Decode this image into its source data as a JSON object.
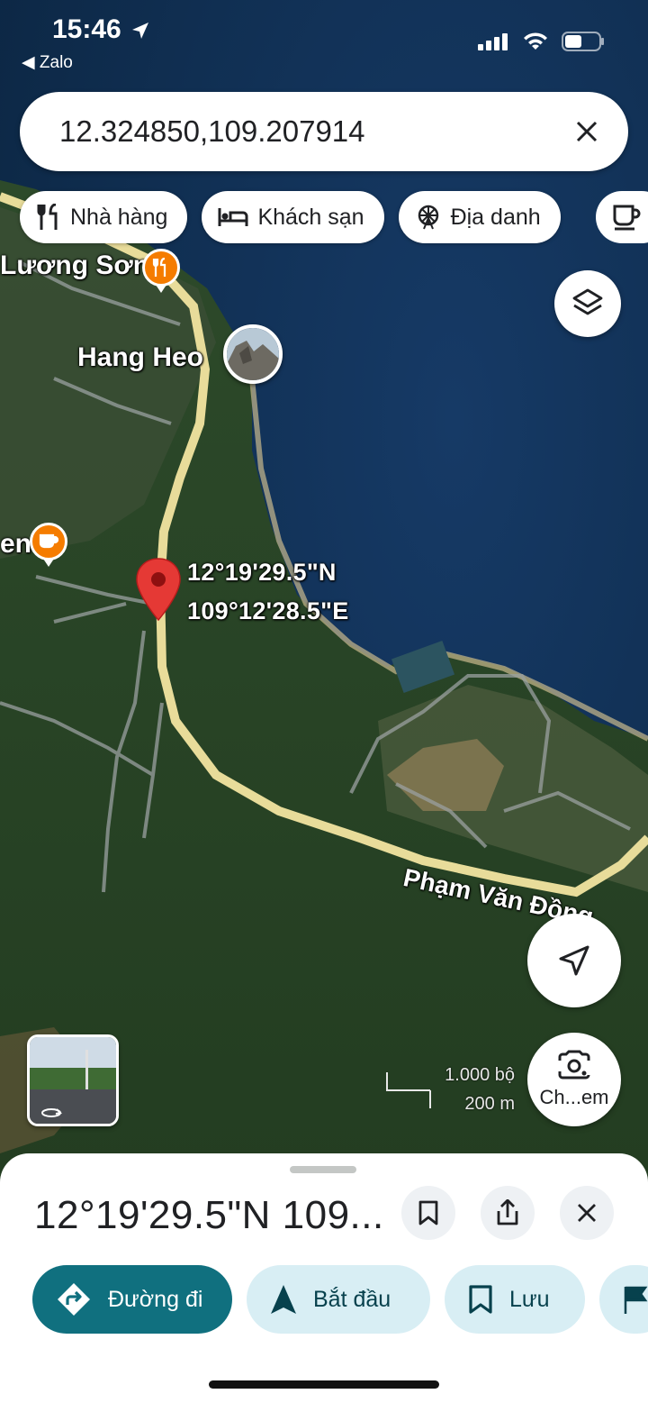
{
  "status_bar": {
    "time": "15:46",
    "back_app": "◀ Zalo"
  },
  "search": {
    "value": "12.324850,109.207914"
  },
  "chips": [
    {
      "label": "Nhà hàng",
      "icon": "fork-knife-icon"
    },
    {
      "label": "Khách sạn",
      "icon": "bed-icon"
    },
    {
      "label": "Địa danh",
      "icon": "ferris-wheel-icon"
    }
  ],
  "map": {
    "labels": {
      "luong_son": "Lương Sơn",
      "hang_heo": "Hang Heo",
      "partial_en": "en",
      "street": "Phạm Văn Đồng"
    },
    "pin": {
      "lat": "12°19'29.5\"N",
      "lng": "109°12'28.5\"E"
    },
    "scale": {
      "imperial": "1.000 bộ",
      "metric": "200 m"
    }
  },
  "lens": {
    "label": "Ch...em"
  },
  "sheet": {
    "title": "12°19'29.5\"N 109...",
    "actions": {
      "directions": "Đường đi",
      "start": "Bắt đầu",
      "save": "Lưu"
    }
  },
  "colors": {
    "primary_action": "#10707f",
    "secondary_action": "#d8eef4",
    "poi_orange": "#f57c00",
    "pin_red": "#e53935",
    "road": "#e8dc9a"
  }
}
